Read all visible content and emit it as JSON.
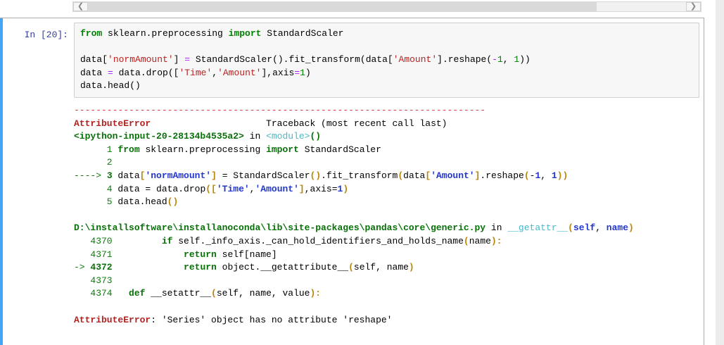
{
  "scrollbar": {
    "left_arrow": "❮",
    "right_arrow": "❯"
  },
  "cell": {
    "prompt": "In [20]:",
    "code_lines": [
      [
        [
          "k",
          "from"
        ],
        [
          "p",
          " sklearn.preprocessing "
        ],
        [
          "k",
          "import"
        ],
        [
          "p",
          " StandardScaler"
        ]
      ],
      [],
      [
        [
          "p",
          "data["
        ],
        [
          "s",
          "'normAmount'"
        ],
        [
          "p",
          "] "
        ],
        [
          "o",
          "="
        ],
        [
          "p",
          " StandardScaler().fit_transform(data["
        ],
        [
          "s",
          "'Amount'"
        ],
        [
          "p",
          "].reshape("
        ],
        [
          "o",
          "-"
        ],
        [
          "n",
          "1"
        ],
        [
          "p",
          ", "
        ],
        [
          "n",
          "1"
        ],
        [
          "p",
          "))"
        ]
      ],
      [
        [
          "p",
          "data "
        ],
        [
          "o",
          "="
        ],
        [
          "p",
          " data.drop(["
        ],
        [
          "s",
          "'Time'"
        ],
        [
          "p",
          ","
        ],
        [
          "s",
          "'Amount'"
        ],
        [
          "p",
          "],axis"
        ],
        [
          "o",
          "="
        ],
        [
          "n",
          "1"
        ],
        [
          "p",
          ")"
        ]
      ],
      [
        [
          "p",
          "data.head()"
        ]
      ]
    ]
  },
  "output": {
    "lines": [
      [
        [
          "r",
          "---------------------------------------------------------------------------"
        ]
      ],
      [
        [
          "rb",
          "AttributeError"
        ],
        [
          "p",
          "                     Traceback (most recent call last)"
        ]
      ],
      [
        [
          "gb",
          "<ipython-input-20-28134b4535a2>"
        ],
        [
          "p",
          " in "
        ],
        [
          "cy",
          "<module>"
        ],
        [
          "gb",
          "()"
        ]
      ],
      [
        [
          "g",
          "      1 "
        ],
        [
          "gb",
          "from"
        ],
        [
          "p",
          " sklearn.preprocessing "
        ],
        [
          "gb",
          "import"
        ],
        [
          "p",
          " StandardScaler"
        ]
      ],
      [
        [
          "g",
          "      2 "
        ]
      ],
      [
        [
          "g",
          "----> "
        ],
        [
          "gb",
          "3"
        ],
        [
          "p",
          " data"
        ],
        [
          "yb",
          "["
        ],
        [
          "bb",
          "'normAmount'"
        ],
        [
          "yb",
          "]"
        ],
        [
          "p",
          " = StandardScaler"
        ],
        [
          "yb",
          "()"
        ],
        [
          "p",
          ".fit_transform"
        ],
        [
          "yb",
          "("
        ],
        [
          "p",
          "data"
        ],
        [
          "yb",
          "["
        ],
        [
          "bb",
          "'Amount'"
        ],
        [
          "yb",
          "]"
        ],
        [
          "p",
          ".reshape"
        ],
        [
          "yb",
          "("
        ],
        [
          "p",
          "-"
        ],
        [
          "bb",
          "1"
        ],
        [
          "p",
          ", "
        ],
        [
          "bb",
          "1"
        ],
        [
          "yb",
          "))"
        ]
      ],
      [
        [
          "g",
          "      4 "
        ],
        [
          "p",
          "data = data.drop"
        ],
        [
          "yb",
          "(["
        ],
        [
          "bb",
          "'Time'"
        ],
        [
          "p",
          ","
        ],
        [
          "bb",
          "'Amount'"
        ],
        [
          "yb",
          "]"
        ],
        [
          "p",
          ",axis="
        ],
        [
          "bb",
          "1"
        ],
        [
          "yb",
          ")"
        ]
      ],
      [
        [
          "g",
          "      5 "
        ],
        [
          "p",
          "data.head"
        ],
        [
          "yb",
          "()"
        ]
      ],
      [],
      [
        [
          "gb",
          "D:\\installsoftware\\installanoconda\\lib\\site-packages\\pandas\\core\\generic.py"
        ],
        [
          "p",
          " in "
        ],
        [
          "cy",
          "__getattr__"
        ],
        [
          "yb",
          "("
        ],
        [
          "bb",
          "self"
        ],
        [
          "p",
          ", "
        ],
        [
          "bb",
          "name"
        ],
        [
          "yb",
          ")"
        ]
      ],
      [
        [
          "g",
          "   4370"
        ],
        [
          "p",
          "         "
        ],
        [
          "gb",
          "if"
        ],
        [
          "p",
          " self._info_axis._can_hold_identifiers_and_holds_name"
        ],
        [
          "yb",
          "("
        ],
        [
          "p",
          "name"
        ],
        [
          "yb",
          "):"
        ]
      ],
      [
        [
          "g",
          "   4371"
        ],
        [
          "p",
          "             "
        ],
        [
          "gb",
          "return"
        ],
        [
          "p",
          " self[name]"
        ]
      ],
      [
        [
          "g",
          "-> "
        ],
        [
          "gb",
          "4372"
        ],
        [
          "p",
          "             "
        ],
        [
          "gb",
          "return"
        ],
        [
          "p",
          " object.__getattribute__"
        ],
        [
          "yb",
          "("
        ],
        [
          "p",
          "self, name"
        ],
        [
          "yb",
          ")"
        ]
      ],
      [
        [
          "g",
          "   4373"
        ]
      ],
      [
        [
          "g",
          "   4374"
        ],
        [
          "p",
          "   "
        ],
        [
          "gb",
          "def"
        ],
        [
          "p",
          " __setattr__"
        ],
        [
          "yb",
          "("
        ],
        [
          "p",
          "self, name, value"
        ],
        [
          "yb",
          "):"
        ]
      ],
      [],
      [
        [
          "rb",
          "AttributeError"
        ],
        [
          "p",
          ": 'Series' object has no attribute 'reshape'"
        ]
      ]
    ]
  },
  "colors": {
    "keyword_green": "#008000",
    "string_red": "#ba2121",
    "operator_purple": "#aa22ff",
    "number_green": "#008000",
    "error_red_bold": "#b22222",
    "ansi_green": "#0a7d0a",
    "ansi_cyan": "#4ab8c4",
    "ansi_blue_bold": "#2337cc",
    "ansi_yellow_bold": "#b8860b",
    "prompt_blue": "#303f9f",
    "selected_cell_bar_blue": "#42a5f5",
    "input_bg": "#f7f7f7"
  }
}
